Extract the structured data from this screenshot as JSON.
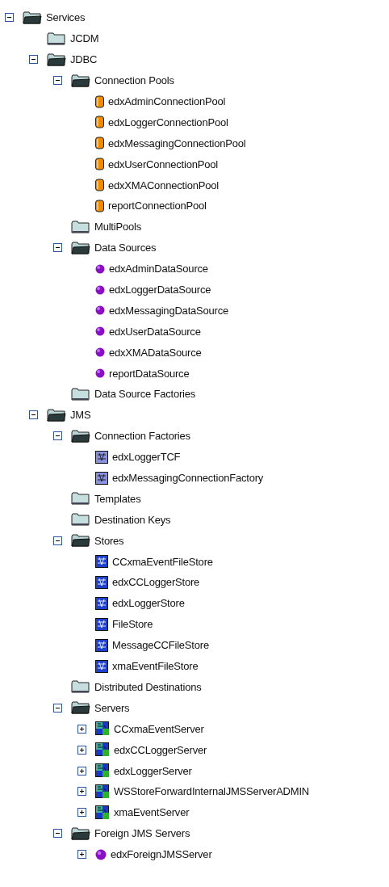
{
  "tree": [
    {
      "label": "Services",
      "kind": "folder",
      "expanded": true,
      "children": [
        {
          "label": "JCDM",
          "kind": "folder"
        },
        {
          "label": "JDBC",
          "kind": "folder",
          "expanded": true,
          "children": [
            {
              "label": "Connection Pools",
              "kind": "folder",
              "expanded": true,
              "children": [
                {
                  "label": "edxAdminConnectionPool",
                  "kind": "pool"
                },
                {
                  "label": "edxLoggerConnectionPool",
                  "kind": "pool"
                },
                {
                  "label": "edxMessagingConnectionPool",
                  "kind": "pool"
                },
                {
                  "label": "edxUserConnectionPool",
                  "kind": "pool"
                },
                {
                  "label": "edxXMAConnectionPool",
                  "kind": "pool"
                },
                {
                  "label": "reportConnectionPool",
                  "kind": "pool"
                }
              ]
            },
            {
              "label": "MultiPools",
              "kind": "folder"
            },
            {
              "label": "Data Sources",
              "kind": "folder",
              "expanded": true,
              "children": [
                {
                  "label": "edxAdminDataSource",
                  "kind": "datasource"
                },
                {
                  "label": "edxLoggerDataSource",
                  "kind": "datasource"
                },
                {
                  "label": "edxMessagingDataSource",
                  "kind": "datasource"
                },
                {
                  "label": "edxUserDataSource",
                  "kind": "datasource"
                },
                {
                  "label": "edxXMADataSource",
                  "kind": "datasource"
                },
                {
                  "label": "reportDataSource",
                  "kind": "datasource"
                }
              ]
            },
            {
              "label": "Data Source Factories",
              "kind": "folder"
            }
          ]
        },
        {
          "label": "JMS",
          "kind": "folder",
          "expanded": true,
          "children": [
            {
              "label": "Connection Factories",
              "kind": "folder",
              "expanded": true,
              "children": [
                {
                  "label": "edxLoggerTCF",
                  "kind": "factory"
                },
                {
                  "label": "edxMessagingConnectionFactory",
                  "kind": "factory"
                }
              ]
            },
            {
              "label": "Templates",
              "kind": "folder"
            },
            {
              "label": "Destination Keys",
              "kind": "folder"
            },
            {
              "label": "Stores",
              "kind": "folder",
              "expanded": true,
              "children": [
                {
                  "label": "CCxmaEventFileStore",
                  "kind": "store"
                },
                {
                  "label": "edxCCLoggerStore",
                  "kind": "store"
                },
                {
                  "label": "edxLoggerStore",
                  "kind": "store"
                },
                {
                  "label": "FileStore",
                  "kind": "store"
                },
                {
                  "label": "MessageCCFileStore",
                  "kind": "store"
                },
                {
                  "label": "xmaEventFileStore",
                  "kind": "store"
                }
              ]
            },
            {
              "label": "Distributed Destinations",
              "kind": "folder"
            },
            {
              "label": "Servers",
              "kind": "folder",
              "expanded": true,
              "children": [
                {
                  "label": "CCxmaEventServer",
                  "kind": "server",
                  "expanded": false
                },
                {
                  "label": "edxCCLoggerServer",
                  "kind": "server",
                  "expanded": false
                },
                {
                  "label": "edxLoggerServer",
                  "kind": "server",
                  "expanded": false
                },
                {
                  "label": "WSStoreForwardInternalJMSServerADMIN",
                  "kind": "server",
                  "expanded": false
                },
                {
                  "label": "xmaEventServer",
                  "kind": "server",
                  "expanded": false
                }
              ]
            },
            {
              "label": "Foreign JMS Servers",
              "kind": "folder",
              "expanded": true,
              "children": [
                {
                  "label": "edxForeignJMSServer",
                  "kind": "foreign",
                  "expanded": false
                }
              ]
            }
          ]
        }
      ]
    }
  ]
}
